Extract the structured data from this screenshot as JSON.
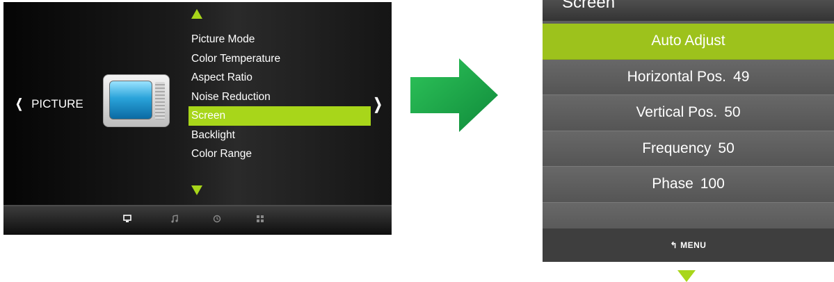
{
  "left_menu": {
    "category": "PICTURE",
    "items": [
      {
        "label": "Picture Mode"
      },
      {
        "label": "Color Temperature"
      },
      {
        "label": "Aspect Ratio"
      },
      {
        "label": "Noise Reduction"
      },
      {
        "label": "Screen",
        "selected": true
      },
      {
        "label": "Backlight"
      },
      {
        "label": "Color Range"
      }
    ],
    "bottom_icons": [
      "picture-icon",
      "music-icon",
      "clock-icon",
      "grid-icon"
    ]
  },
  "right_menu": {
    "title": "Screen",
    "items": [
      {
        "label": "Auto Adjust",
        "value": "",
        "selected": true
      },
      {
        "label": "Horizontal Pos.",
        "value": "49"
      },
      {
        "label": "Vertical Pos.",
        "value": "50"
      },
      {
        "label": "Frequency",
        "value": "50"
      },
      {
        "label": "Phase",
        "value": "100"
      },
      {
        "label": "",
        "value": ""
      }
    ],
    "footer_label": "MENU"
  },
  "colors": {
    "accent": "#a8d61a",
    "selected_row": "#9dc21c",
    "arrow": "#1fa84a"
  }
}
